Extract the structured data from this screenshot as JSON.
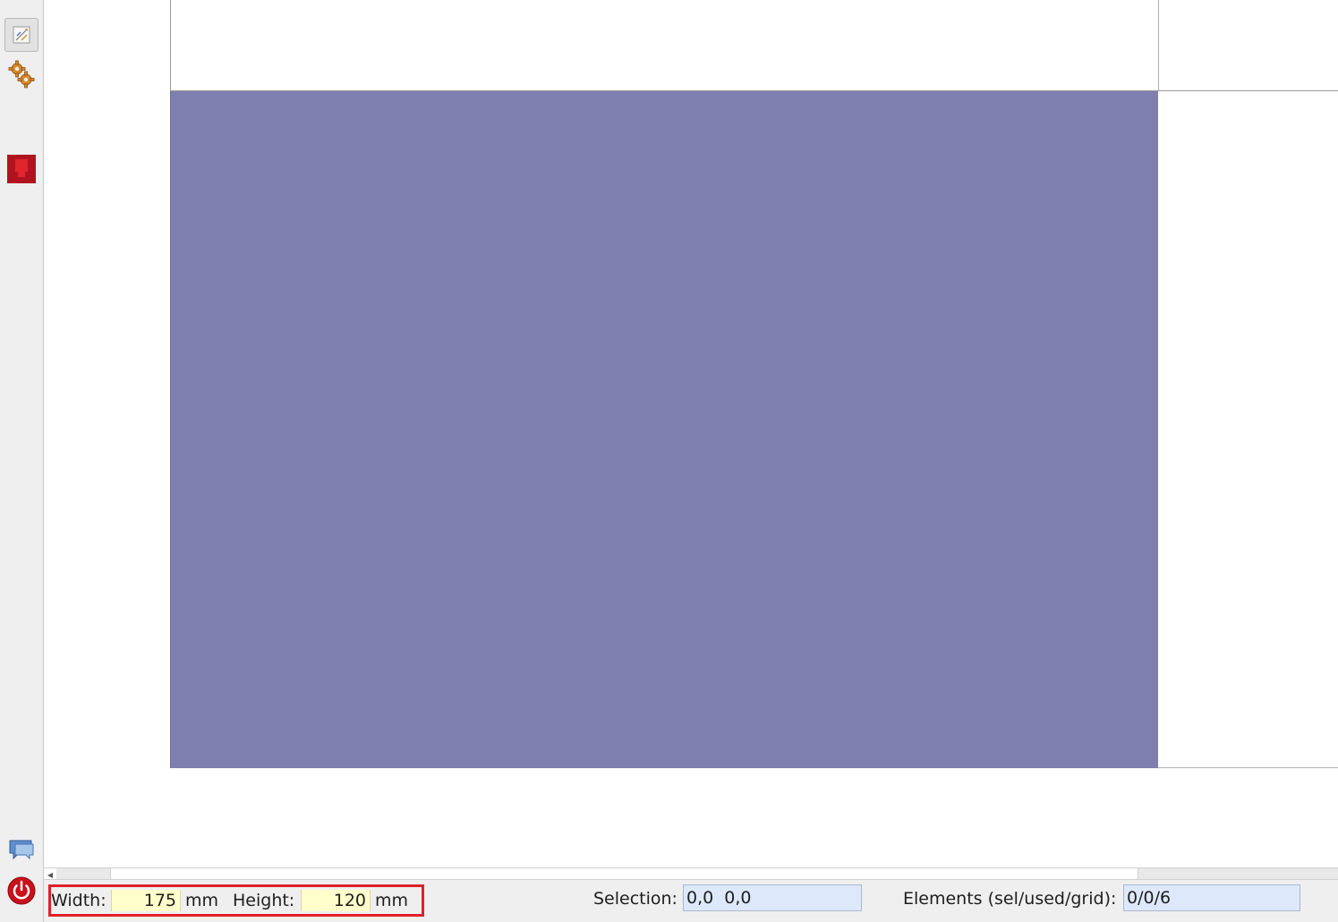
{
  "left_toolbar": {
    "items": [
      {
        "name": "edit-pen-icon",
        "active": true
      },
      {
        "name": "gears-icon",
        "active": false
      },
      {
        "name": "red-block-icon",
        "active": false
      },
      {
        "name": "chat-icon",
        "active": false
      },
      {
        "name": "power-icon",
        "active": false
      }
    ]
  },
  "status_bar": {
    "width_label": "Width:",
    "width_value": "175",
    "width_unit": "mm",
    "height_label": "Height:",
    "height_value": "120",
    "height_unit": "mm",
    "selection_label": "Selection:",
    "selection_value": "0,0  0,0",
    "elements_label": "Elements (sel/used/grid):",
    "elements_value": "0/0/6"
  },
  "colors": {
    "display_fill": "#7f7faf",
    "highlight_border": "#e0202a",
    "numeric_field_bg": "#ffffcc",
    "info_field_bg": "#dde9fb"
  }
}
